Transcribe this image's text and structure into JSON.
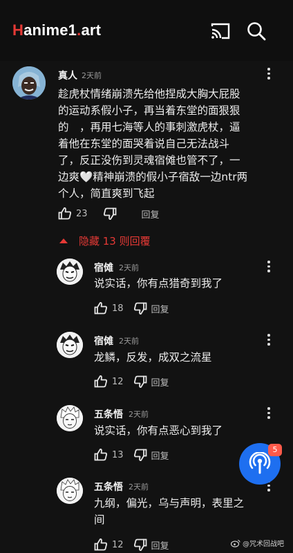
{
  "header": {
    "logo_h": "H",
    "logo_mid": "anime1",
    "logo_dot": ".",
    "logo_end": "art",
    "icons": [
      "cast-icon",
      "search-icon"
    ]
  },
  "main_comment": {
    "user": "真人",
    "time": "2天前",
    "lines": [
      "趁虎杖情绪崩溃先给他捏成大胸大屁股",
      "的运动系假小子，再当着东堂的面狠狠",
      "的　，再用七海等人的事刺激虎杖，逼",
      "着他在东堂的面哭着说自己无法战斗",
      "了，反正没伤到灵魂宿傩也管不了，一",
      "边爽🤍精神崩溃的假小子宿敌一边ntr两",
      "个人，简直爽到飞起"
    ],
    "likes": "23",
    "reply_label": "回复"
  },
  "hidden_replies": "隐藏 13 则回覆",
  "replies": [
    {
      "user": "宿傩",
      "time": "2天前",
      "lines": [
        "说实话，你有点猎奇到我了"
      ],
      "likes": "18",
      "reply_label": "回复"
    },
    {
      "user": "宿傩",
      "time": "2天前",
      "lines": [
        "龙鳞，反发，成双之流星"
      ],
      "likes": "12",
      "reply_label": "回复"
    },
    {
      "user": "五条悟",
      "time": "2天前",
      "lines": [
        "说实话，你有点恶心到我了"
      ],
      "likes": "13",
      "reply_label": "回复"
    },
    {
      "user": "五条悟",
      "time": "2天前",
      "lines": [
        "九纲，偏光，乌与声明，表里之",
        "间"
      ],
      "likes": "12",
      "reply_label": "回复"
    }
  ],
  "fab": {
    "badge": "5",
    "icon": "podcast-icon"
  },
  "watermark": "@咒术回战吧",
  "colors": {
    "accent_red": "#e53935",
    "fab_blue": "#1e6ff0",
    "badge_red": "#ff5a4a"
  }
}
